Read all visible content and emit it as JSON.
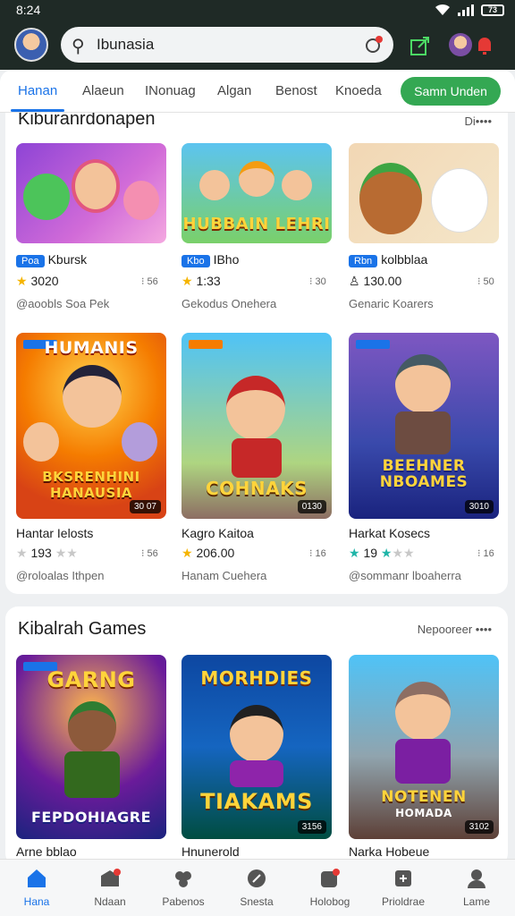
{
  "status": {
    "time": "8:24",
    "battery": "73"
  },
  "search": {
    "query": "Ibunasia"
  },
  "tabs": [
    "Hanan",
    "Alaeun",
    "INonuag",
    "Algan",
    "Benost",
    "Knoeda"
  ],
  "tab_button": "Samn  Unden",
  "section1": {
    "title": "Kiburanrdonapen",
    "more": "Di••••",
    "games": [
      {
        "art": "",
        "badge": "Poa",
        "name": "Kbursk",
        "rating": "3020",
        "side": "⁝ 56",
        "sub": "@aoobls Soa Pek"
      },
      {
        "art": "HUBBAIN LEHRI",
        "badge": "Kbo",
        "name": "IBho",
        "rating": "1:33",
        "side": "⁝ 30",
        "sub": "Gekodus Onehera"
      },
      {
        "art": "",
        "badge": "Rbn",
        "name": "kolbblaa",
        "rating": "130.00",
        "side": "⁝ 50",
        "sub": "Genaric Koarers"
      },
      {
        "art": "HUMANIS",
        "art2": "BKSRENHINI HANAUSIA",
        "size": "30 07",
        "name": "Hantar Ielosts",
        "rating": "193",
        "side": "⁝ 56",
        "sub": "@roloalas Ithpen"
      },
      {
        "art": "COHNAKS",
        "size": "0130",
        "name": "Kagro Kaitoa",
        "rating": "206.00",
        "side": "⁝ 16",
        "sub": "Hanam Cuehera"
      },
      {
        "art": "BEEHNER NBOAMES",
        "size": "3010",
        "name": "Harkat Kosecs",
        "rating": "19",
        "side": "⁝ 16",
        "sub": "@sommanr lboaherra"
      }
    ]
  },
  "section2": {
    "title": "Kibalrah Games",
    "more": "Nepooreer ••••",
    "games": [
      {
        "art": "GARNG",
        "art2": "FEPDOHIAGRE",
        "name": "Arne bblao"
      },
      {
        "art": "MORHDIES",
        "art2": "TIAKAMS",
        "size": "3156",
        "name": "Hnunerold"
      },
      {
        "art": "NOTENEN",
        "art2": "HOMADA",
        "size": "3102",
        "name": "Narka Hobeue"
      }
    ]
  },
  "bottomnav": [
    "Hana",
    "Ndaan",
    "Pabenos",
    "Snesta",
    "Holobog",
    "Prioldrae",
    "Lame"
  ]
}
